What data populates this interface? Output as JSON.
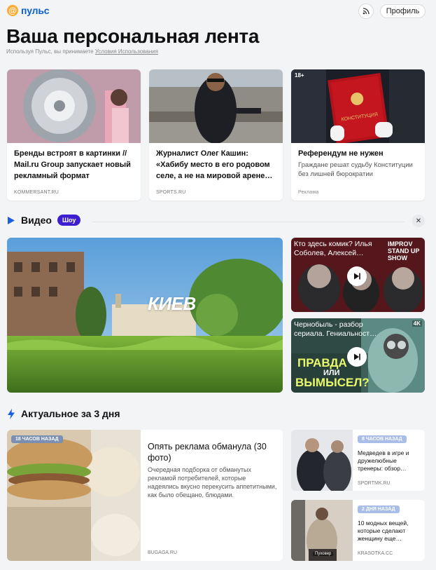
{
  "header": {
    "logo_text": "пульс",
    "profile_label": "Профиль"
  },
  "page": {
    "title": "Ваша персональная лента",
    "terms_prefix": "Используя Пульс, вы принимаете",
    "terms_link": "Условия Использования"
  },
  "top_cards": [
    {
      "title": "Бренды встроят в картинки // Mail.ru Group запускает новый рекламный формат",
      "source": "KOMMERSANT.RU"
    },
    {
      "title": "Журналист Олег Кашин: «Хабибу место в его родовом селе, а не на мировой арене…",
      "source": "SPORTS.RU"
    },
    {
      "title": "Референдум не нужен",
      "description": "Граждане решат судьбу Конституции без лишней бюрократии",
      "source": "Реклама",
      "age": "18+"
    }
  ],
  "video_section": {
    "title": "Видео",
    "badge": "Шоу",
    "main_title": "КИЕВ",
    "side": [
      {
        "title": "Кто здесь комик? Илья Соболев, Алексей…",
        "overlay": "IMPROV STAND UP SHOW"
      },
      {
        "title": "Чернобыль - разбор сериала. Гениальност…",
        "overlay_line1": "ПРАВДА",
        "overlay_mid": "ИЛИ",
        "overlay_line2": "ВЫМЫСЕЛ?",
        "badge": "4K"
      }
    ]
  },
  "actual_section": {
    "title": "Актуальное за 3 дня",
    "big": {
      "badge": "18 часов назад",
      "title": "Опять реклама обманула (30 фото)",
      "description": "Очередная подборка от обманутых рекламой потребителей, которые надеялись вкусно перекусить аппетитными, как было обещано, блюдами.",
      "source": "BUGAGA.RU"
    },
    "small": [
      {
        "badge": "8 часов назад",
        "title": "Медведев в игре и дружелюбные тренеры: обзор…",
        "source": "SPORTMK.RU"
      },
      {
        "badge": "2 дня назад",
        "title": "10 модных вещей, которые сделают женщину еще…",
        "source": "KRASOTKA.CC",
        "img_label": "Пуховер"
      }
    ]
  }
}
